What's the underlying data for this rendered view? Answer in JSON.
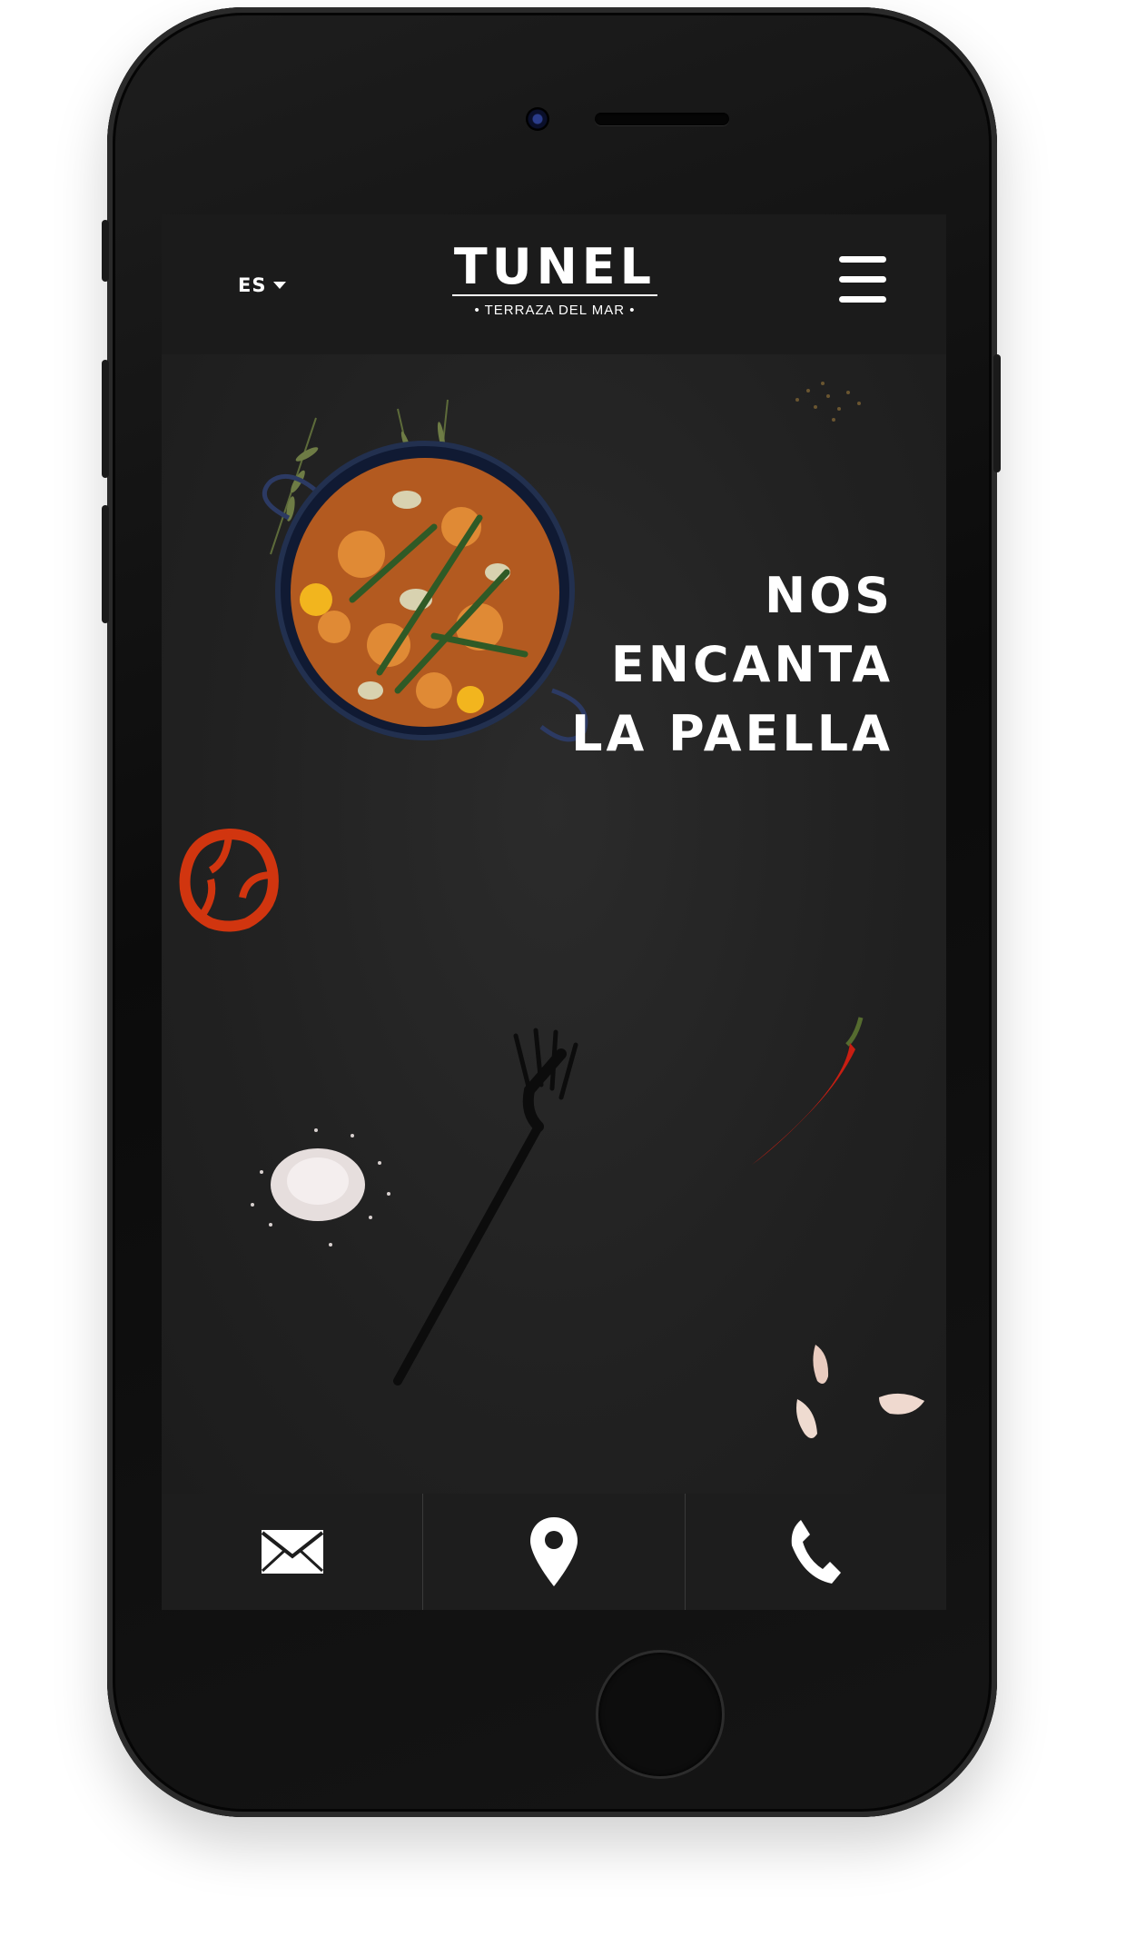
{
  "header": {
    "language": "ES",
    "logo_title": "TUNEL",
    "logo_subtitle": "• TERRAZA DEL MAR •",
    "menu_icon": "hamburger-menu-icon"
  },
  "hero": {
    "headline_line1": "NOS",
    "headline_line2": "ENCANTA",
    "headline_line3": "LA PAELLA"
  },
  "bottom_nav": {
    "items": [
      {
        "icon": "envelope-icon"
      },
      {
        "icon": "location-pin-icon"
      },
      {
        "icon": "phone-icon"
      }
    ]
  },
  "colors": {
    "screen_bg": "#222222",
    "header_bg": "#1b1b1b",
    "text": "#ffffff"
  }
}
